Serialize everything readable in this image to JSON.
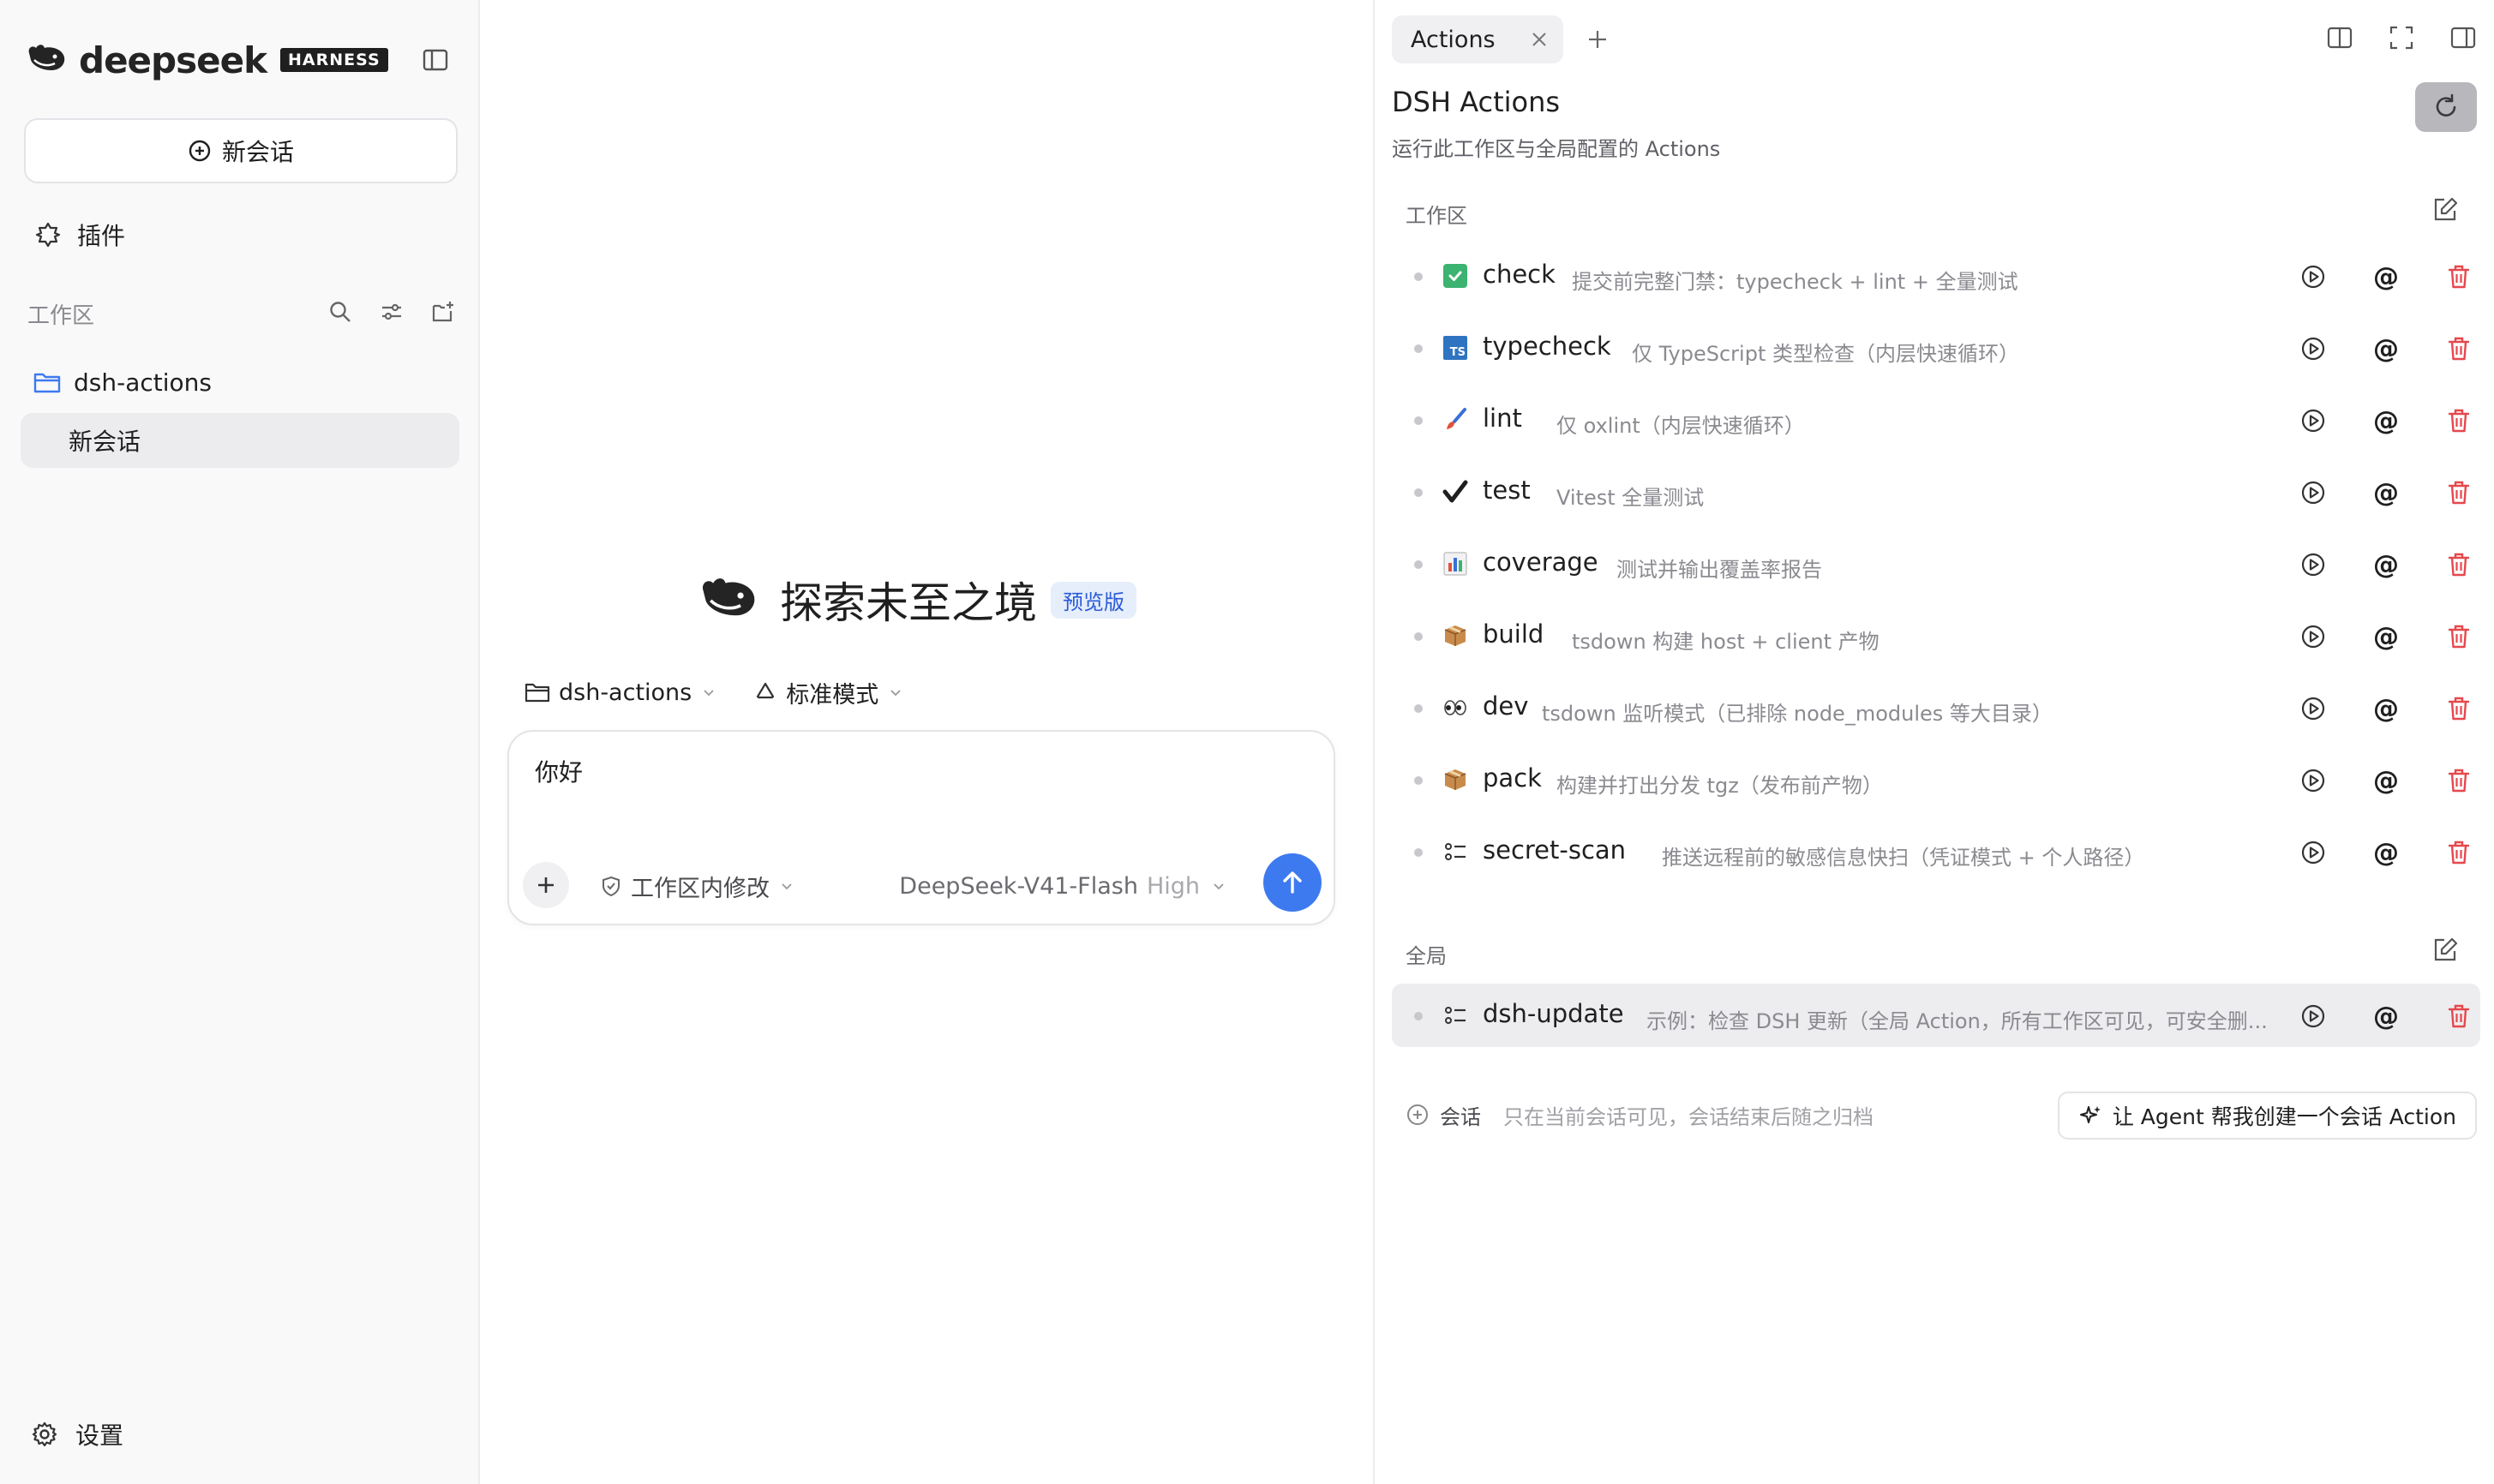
{
  "sidebar": {
    "brand": "deepseek",
    "brand_tag": "HARNESS",
    "new_chat": "新会话",
    "plugins": "插件",
    "workspace_label": "工作区",
    "folder": "dsh-actions",
    "session": "新会话",
    "settings": "设置"
  },
  "center": {
    "hero_title": "探索未至之境",
    "hero_badge": "预览版",
    "context_folder": "dsh-actions",
    "context_mode": "标准模式",
    "input_text": "你好",
    "permission": "工作区内修改",
    "model": "DeepSeek-V41-Flash",
    "model_level": "High"
  },
  "panel": {
    "tab_label": "Actions",
    "title": "DSH Actions",
    "subtitle": "运行此工作区与全局配置的 Actions",
    "workspace_section": "工作区",
    "global_section": "全局",
    "session_label": "会话",
    "session_hint": "只在当前会话可见，会话结束后随之归档",
    "agent_button": "让 Agent 帮我创建一个会话 Action",
    "at_symbol": "@",
    "workspace_actions": [
      {
        "icon": "check-mark-icon",
        "name": "check",
        "desc": "提交前完整门禁：typecheck + lint + 全量测试"
      },
      {
        "icon": "typescript-icon",
        "name": "typecheck",
        "desc": "仅 TypeScript 类型检查（内层快速循环）"
      },
      {
        "icon": "paintbrush-icon",
        "name": "lint",
        "desc": "仅 oxlint（内层快速循环）"
      },
      {
        "icon": "checkmark-icon",
        "name": "test",
        "desc": "Vitest 全量测试"
      },
      {
        "icon": "bar-chart-icon",
        "name": "coverage",
        "desc": "测试并输出覆盖率报告"
      },
      {
        "icon": "package-icon",
        "name": "build",
        "desc": "tsdown 构建 host + client 产物"
      },
      {
        "icon": "eyes-icon",
        "name": "dev",
        "desc": "tsdown 监听模式（已排除 node_modules 等大目录）"
      },
      {
        "icon": "package-icon",
        "name": "pack",
        "desc": "构建并打出分发 tgz（发布前产物）"
      },
      {
        "icon": "list-icon",
        "name": "secret-scan",
        "desc": "推送远程前的敏感信息快扫（凭证模式 + 个人路径）"
      }
    ],
    "global_actions": [
      {
        "icon": "list-icon",
        "name": "dsh-update",
        "desc": "示例：检查 DSH 更新（全局 Action，所有工作区可见，可安全删..."
      }
    ]
  },
  "colors": {
    "accent": "#3d7af0",
    "delete": "#e5484d",
    "sidebar_bg": "#f9f9fa"
  }
}
